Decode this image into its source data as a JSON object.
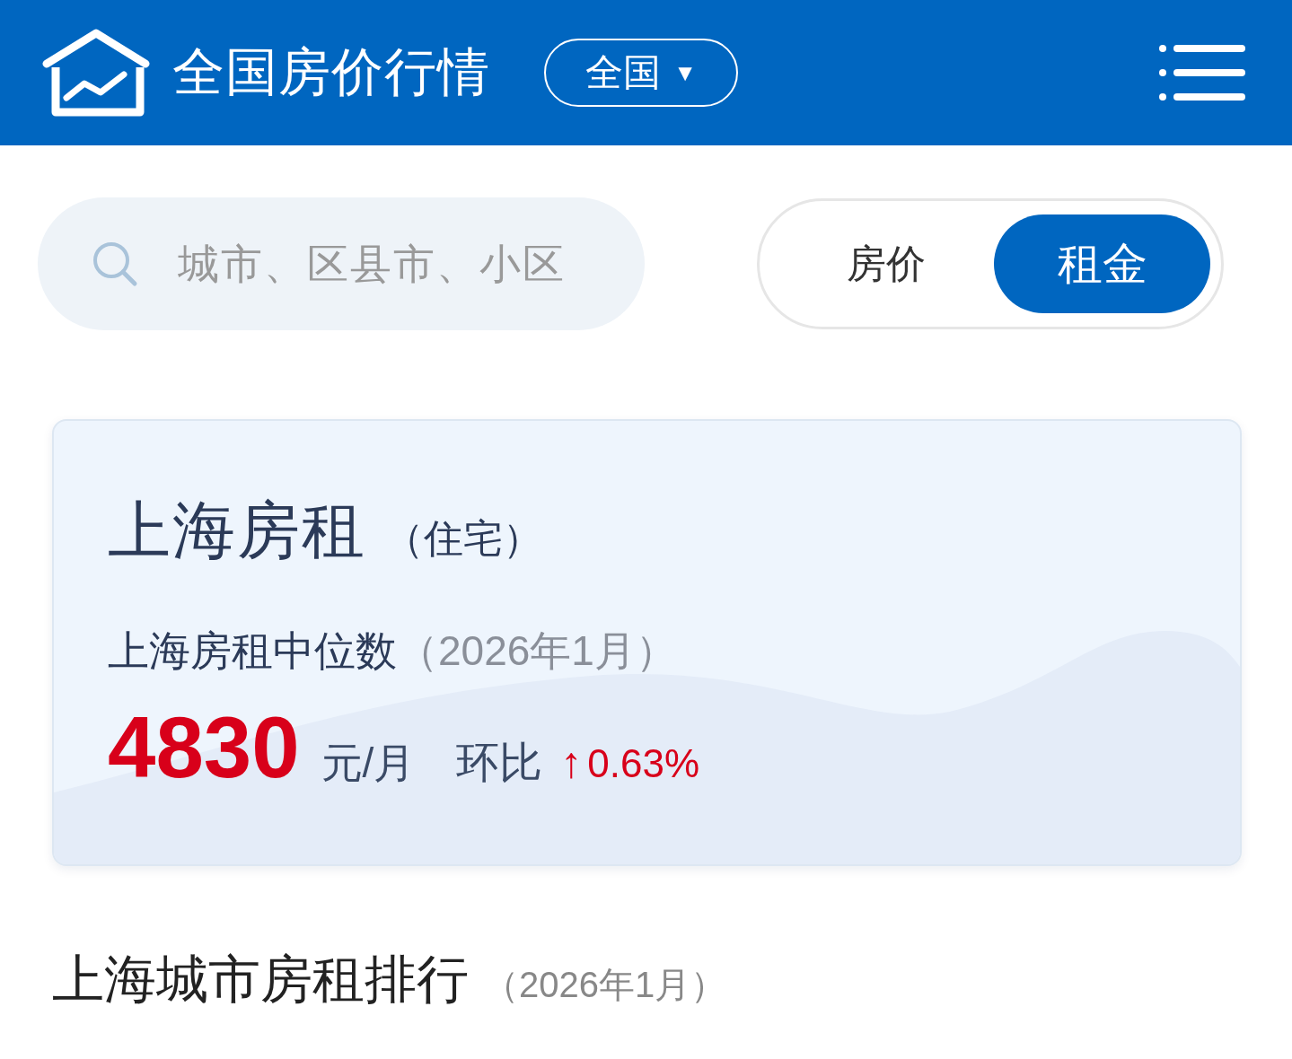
{
  "header": {
    "title": "全国房价行情",
    "region_button": {
      "label": "全国",
      "caret": "▼"
    }
  },
  "search": {
    "placeholder": "城市、区县市、小区"
  },
  "mode_tabs": [
    {
      "label": "房价",
      "selected": false
    },
    {
      "label": "租金",
      "selected": true
    }
  ],
  "summary_card": {
    "title": "上海房租",
    "title_note": "（住宅）",
    "subtitle": "上海房租中位数",
    "subtitle_period": "（2026年1月）",
    "value": "4830",
    "unit": "元/月",
    "change_label": "环比",
    "change_arrow": "↑",
    "change_value": "0.63%"
  },
  "ranking": {
    "title": "上海城市房租排行",
    "period": "（2026年1月）"
  }
}
